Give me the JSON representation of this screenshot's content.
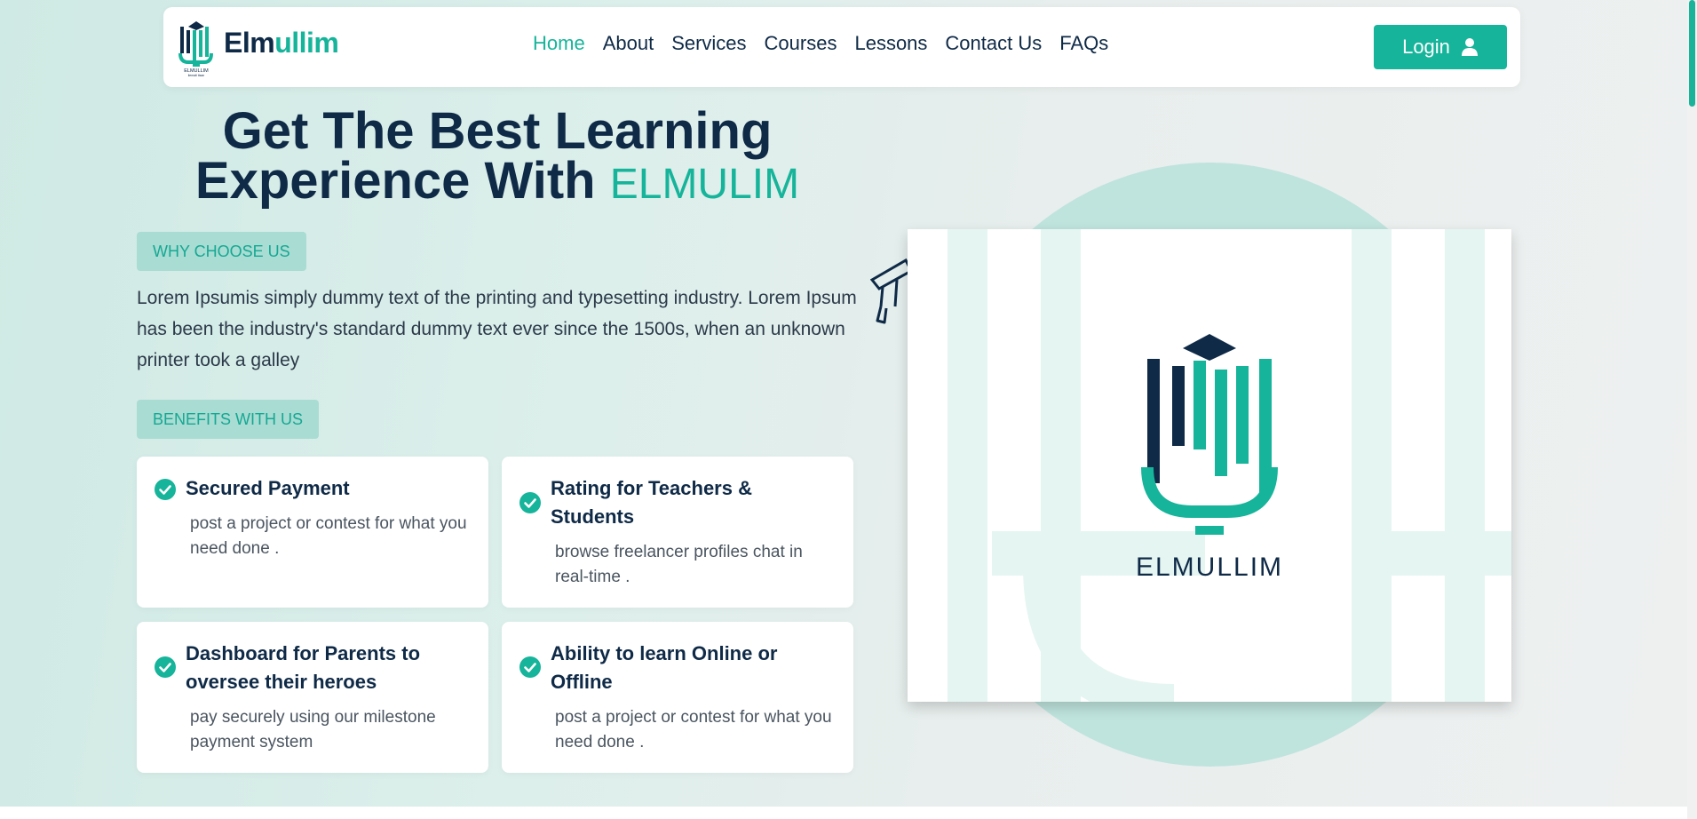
{
  "brand": {
    "name_part1": "Elm",
    "name_part2": "ullim",
    "logo_small_text": "ELMULLIM",
    "logo_small_subtext": "ilemati tisan",
    "caption": "ELMULLIM"
  },
  "nav": {
    "items": [
      {
        "label": "Home",
        "active": true
      },
      {
        "label": "About",
        "active": false
      },
      {
        "label": "Services",
        "active": false
      },
      {
        "label": "Courses",
        "active": false
      },
      {
        "label": "Lessons",
        "active": false
      },
      {
        "label": "Contact Us",
        "active": false
      },
      {
        "label": "FAQs",
        "active": false
      }
    ],
    "login_label": "Login"
  },
  "hero": {
    "heading_line1": "Get The Best Learning",
    "heading_line2_prefix": "Experience With ",
    "heading_accent": "ELMULIM",
    "why_pill": "WHY CHOOSE US",
    "intro": "Lorem Ipsumis simply dummy text of the printing and typesetting industry. Lorem Ipsum has been the industry's standard dummy text ever since the 1500s, when an unknown printer took a galley",
    "benefits_pill": "BENEFITS WITH US"
  },
  "benefits": [
    {
      "title": "Secured Payment",
      "desc": "post a project or contest for what you need done ."
    },
    {
      "title": "Rating for Teachers & Students",
      "desc": "browse freelancer profiles chat in real-time ."
    },
    {
      "title": "Dashboard for Parents to oversee their heroes",
      "desc": "pay securely using our milestone payment system"
    },
    {
      "title": "Ability to learn Online or Offline",
      "desc": "post a project or contest for what you need done ."
    }
  ],
  "colors": {
    "primary": "#16b49a",
    "navy": "#0f2a47",
    "pill_bg": "#a9dcd3"
  }
}
